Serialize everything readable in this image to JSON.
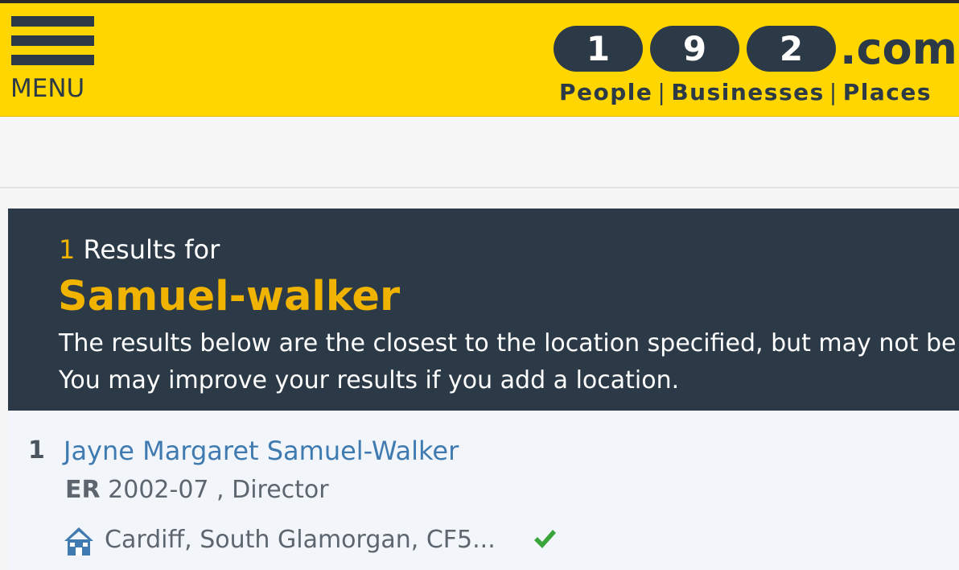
{
  "header": {
    "menu_label": "MENU",
    "logo": {
      "digits": [
        "1",
        "9",
        "2"
      ],
      "domain_suffix": ".com",
      "tagline": [
        "People",
        "Businesses",
        "Places"
      ],
      "tagline_separator": "|"
    },
    "colors": {
      "background": "#ffd600",
      "dark": "#2c3a47"
    }
  },
  "results_header": {
    "count": "1",
    "count_label": "Results for",
    "search_term": "Samuel-walker",
    "notice_line1": "The results below are the closest to the location specified, but may not be in",
    "notice_line2": "You may improve your results if you add a location.",
    "colors": {
      "background": "#2c3a47",
      "accent": "#f0b400"
    }
  },
  "results": [
    {
      "index": "1",
      "name": "Jayne Margaret Samuel-Walker",
      "source": "ER",
      "meta": "2002-07 , Director",
      "address": "Cardiff, South Glamorgan, CF5...",
      "address_icon": "house-icon",
      "verified_icon": "checkmark-icon"
    }
  ]
}
